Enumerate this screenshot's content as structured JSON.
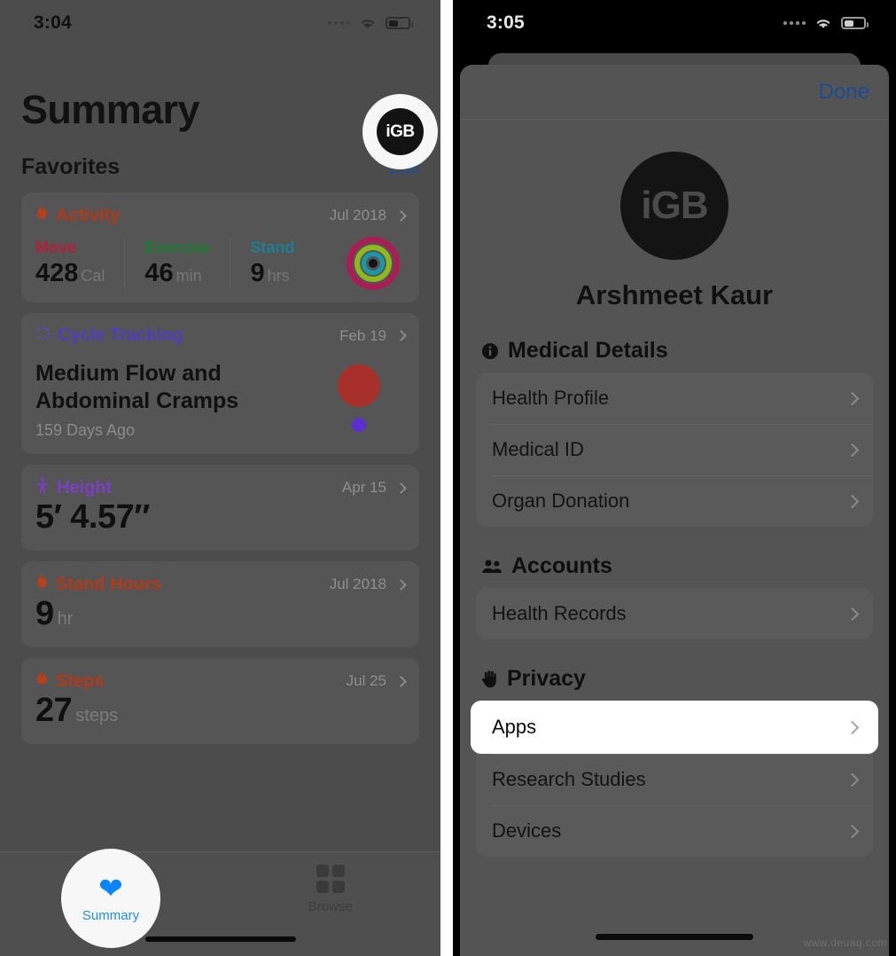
{
  "left": {
    "status_bar": {
      "time": "3:04",
      "wifi_icon": "wifi-icon",
      "battery_icon": "battery-icon",
      "signal_icon": "signal-dots-icon"
    },
    "page_title": "Summary",
    "favorites_header": {
      "title": "Favorites",
      "edit_label": "Edit"
    },
    "logo_badge": "iGB",
    "cards": [
      {
        "id": "activity",
        "icon": "flame-icon",
        "title": "Activity",
        "title_color": "#b03a1a",
        "date": "Jul 2018",
        "stats": [
          {
            "label": "Move",
            "label_color": "#b5203c",
            "value": "428",
            "unit": "Cal"
          },
          {
            "label": "Exercise",
            "label_color": "#1d7a33",
            "value": "46",
            "unit": "min"
          },
          {
            "label": "Stand",
            "label_color": "#1d7f91",
            "value": "9",
            "unit": "hrs"
          }
        ],
        "rings_icon": "activity-rings-icon"
      },
      {
        "id": "cycle-tracking",
        "icon": "cycle-dots-icon",
        "title": "Cycle Tracking",
        "title_color": "#4f3fbf",
        "date": "Feb 19",
        "headline": "Medium Flow and Abdominal Cramps",
        "subtext": "159 Days Ago",
        "flow_dot_color": "#a7302a",
        "symptom_dot_color": "#5b2fd0"
      },
      {
        "id": "height",
        "icon": "person-icon",
        "title": "Height",
        "title_color": "#7b3fc4",
        "date": "Apr 15",
        "value": "5′ 4.57″",
        "unit": ""
      },
      {
        "id": "stand-hours",
        "icon": "flame-icon",
        "title": "Stand Hours",
        "title_color": "#b03a1a",
        "date": "Jul 2018",
        "value": "9",
        "unit": "hr"
      },
      {
        "id": "steps",
        "icon": "flame-icon",
        "title": "Steps",
        "title_color": "#b03a1a",
        "date": "Jul 25",
        "value": "27",
        "unit": "steps"
      }
    ],
    "tabbar": {
      "tabs": [
        {
          "id": "summary",
          "label": "Summary",
          "icon": "heart-icon",
          "selected": true
        },
        {
          "id": "browse",
          "label": "Browse",
          "icon": "grid-icon",
          "selected": false
        }
      ]
    }
  },
  "right": {
    "status_bar": {
      "time": "3:05",
      "wifi_icon": "wifi-icon",
      "battery_icon": "battery-icon",
      "signal_icon": "signal-dots-icon"
    },
    "sheet": {
      "done_label": "Done",
      "avatar_text": "iGB",
      "profile_name": "Arshmeet Kaur",
      "sections": [
        {
          "id": "medical-details",
          "icon": "info-circle-icon",
          "title": "Medical Details",
          "rows": [
            {
              "id": "health-profile",
              "label": "Health Profile",
              "highlighted": false
            },
            {
              "id": "medical-id",
              "label": "Medical ID",
              "highlighted": false
            },
            {
              "id": "organ-donation",
              "label": "Organ Donation",
              "highlighted": false
            }
          ]
        },
        {
          "id": "accounts",
          "icon": "people-icon",
          "title": "Accounts",
          "rows": [
            {
              "id": "health-records",
              "label": "Health Records",
              "highlighted": false
            }
          ]
        },
        {
          "id": "privacy",
          "icon": "hand-raised-icon",
          "title": "Privacy",
          "rows": [
            {
              "id": "apps",
              "label": "Apps",
              "highlighted": true
            },
            {
              "id": "research-studies",
              "label": "Research Studies",
              "highlighted": false
            },
            {
              "id": "devices",
              "label": "Devices",
              "highlighted": false
            }
          ]
        }
      ]
    }
  },
  "watermark": "www.deuaq.com"
}
